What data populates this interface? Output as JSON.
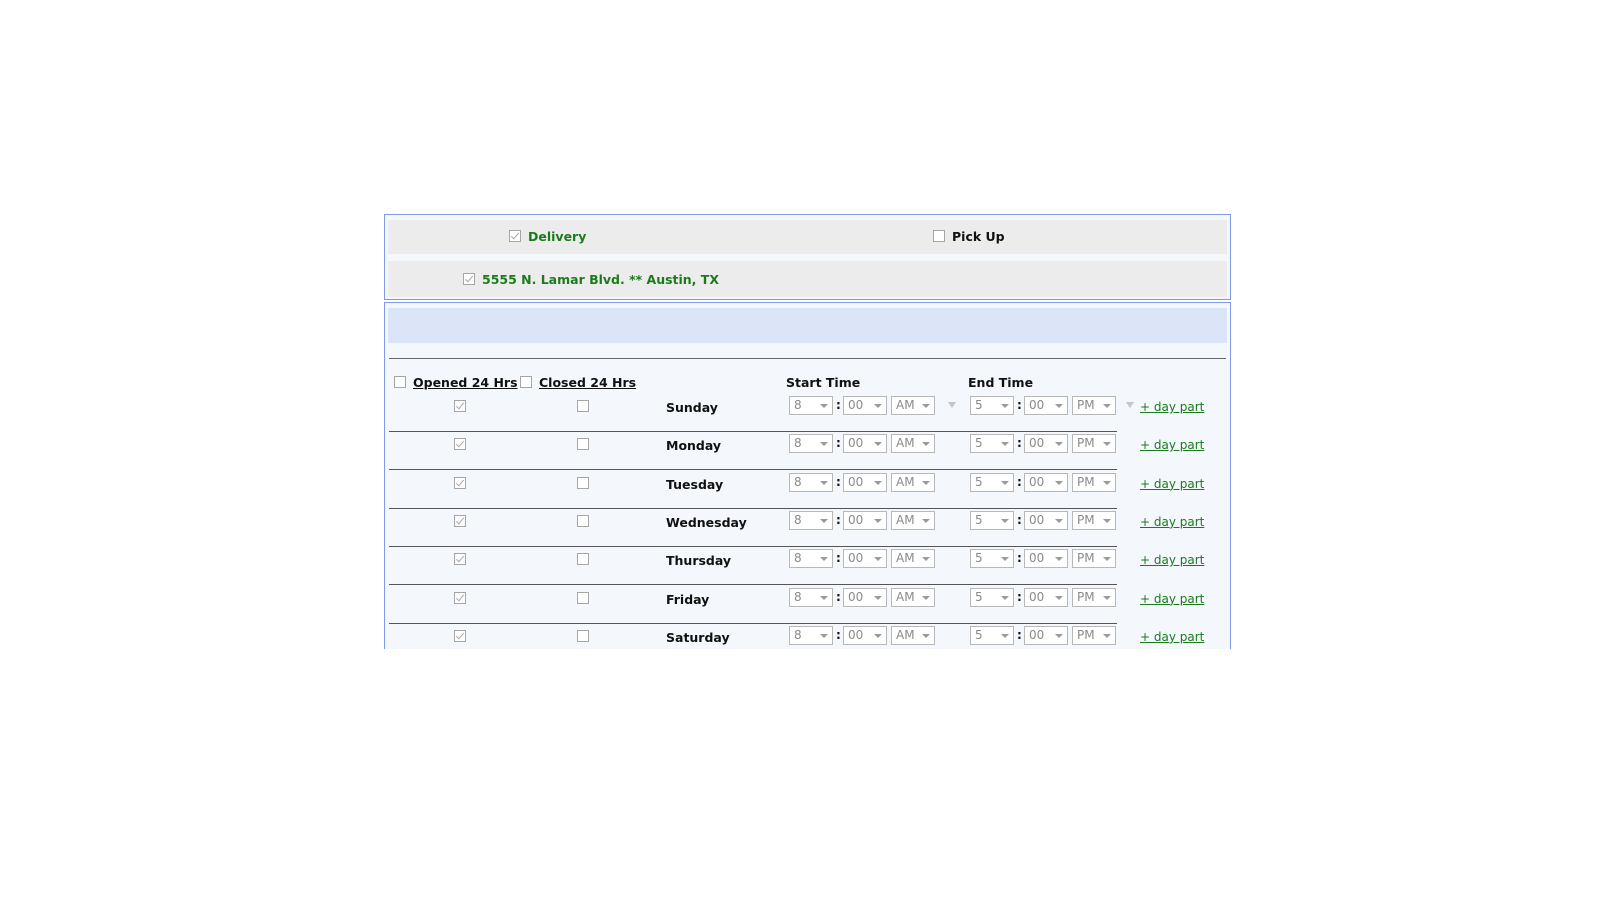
{
  "services": {
    "delivery_label": "Delivery",
    "delivery_checked": true,
    "pickup_label": "Pick Up",
    "pickup_checked": false
  },
  "location": {
    "address": "5555 N. Lamar Blvd. ** Austin, TX",
    "checked": true
  },
  "hours": {
    "opened_24_label": "Opened 24 Hrs",
    "closed_24_label": "Closed 24 Hrs",
    "start_time_label": "Start Time",
    "end_time_label": "End Time",
    "colon": ":",
    "add_day_part_label": "+ day part",
    "days": [
      {
        "name": "Sunday",
        "opened_24": true,
        "closed_24": false,
        "start_hour": "8",
        "start_min": "00",
        "start_ampm": "AM",
        "end_hour": "5",
        "end_min": "00",
        "end_ampm": "PM"
      },
      {
        "name": "Monday",
        "opened_24": true,
        "closed_24": false,
        "start_hour": "8",
        "start_min": "00",
        "start_ampm": "AM",
        "end_hour": "5",
        "end_min": "00",
        "end_ampm": "PM"
      },
      {
        "name": "Tuesday",
        "opened_24": true,
        "closed_24": false,
        "start_hour": "8",
        "start_min": "00",
        "start_ampm": "AM",
        "end_hour": "5",
        "end_min": "00",
        "end_ampm": "PM"
      },
      {
        "name": "Wednesday",
        "opened_24": true,
        "closed_24": false,
        "start_hour": "8",
        "start_min": "00",
        "start_ampm": "AM",
        "end_hour": "5",
        "end_min": "00",
        "end_ampm": "PM"
      },
      {
        "name": "Thursday",
        "opened_24": true,
        "closed_24": false,
        "start_hour": "8",
        "start_min": "00",
        "start_ampm": "AM",
        "end_hour": "5",
        "end_min": "00",
        "end_ampm": "PM"
      },
      {
        "name": "Friday",
        "opened_24": true,
        "closed_24": false,
        "start_hour": "8",
        "start_min": "00",
        "start_ampm": "AM",
        "end_hour": "5",
        "end_min": "00",
        "end_ampm": "PM"
      },
      {
        "name": "Saturday",
        "opened_24": true,
        "closed_24": false,
        "start_hour": "8",
        "start_min": "00",
        "start_ampm": "AM",
        "end_hour": "5",
        "end_min": "00",
        "end_ampm": "PM"
      }
    ]
  },
  "colors": {
    "accent_green": "#1b7b1b",
    "border_blue": "#7f9be6",
    "header_bar": "#dce5f7"
  }
}
